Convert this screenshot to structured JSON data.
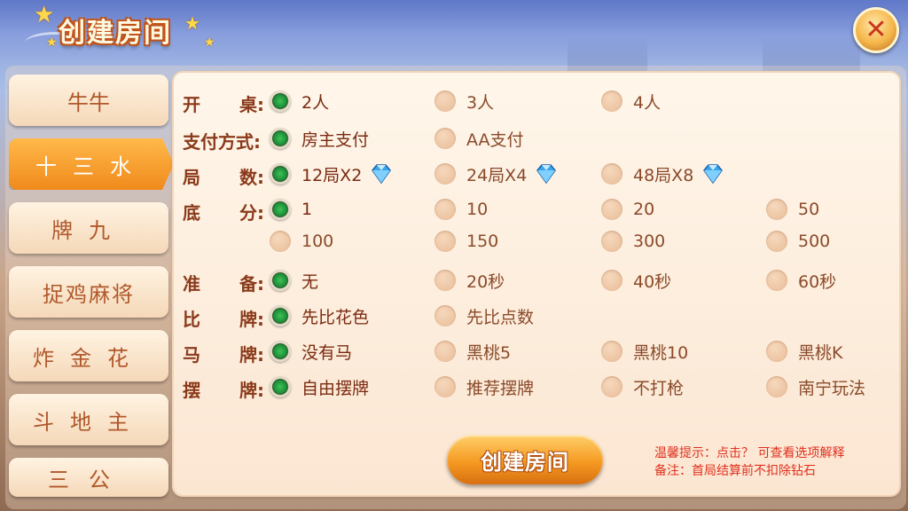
{
  "header": {
    "title": "创建房间",
    "close_icon": "close-icon"
  },
  "game_tabs": [
    {
      "label": "牛牛",
      "active": false
    },
    {
      "label": "十三水",
      "active": true
    },
    {
      "label": "牌九",
      "active": false
    },
    {
      "label": "捉鸡麻将",
      "active": false
    },
    {
      "label": "炸金花",
      "active": false
    },
    {
      "label": "斗地主",
      "active": false
    },
    {
      "label": "三公",
      "active": false
    }
  ],
  "settings": {
    "table_size": {
      "label_a": "开",
      "label_b": "桌:",
      "options": [
        "2人",
        "3人",
        "4人"
      ],
      "selected": 0
    },
    "payment": {
      "label": "支付方式:",
      "options": [
        "房主支付",
        "AA支付"
      ],
      "selected": 0
    },
    "rounds": {
      "label_a": "局",
      "label_b": "数:",
      "options": [
        "12局X2",
        "24局X4",
        "48局X8"
      ],
      "selected": 0,
      "icon": "diamond-icon"
    },
    "base_score": {
      "label_a": "底",
      "label_b": "分:",
      "options": [
        "1",
        "10",
        "20",
        "50",
        "100",
        "150",
        "300",
        "500"
      ],
      "selected": 0
    },
    "ready": {
      "label_a": "准",
      "label_b": "备:",
      "options": [
        "无",
        "20秒",
        "40秒",
        "60秒"
      ],
      "selected": 0
    },
    "compare": {
      "label_a": "比",
      "label_b": "牌:",
      "options": [
        "先比花色",
        "先比点数"
      ],
      "selected": 0
    },
    "horse_card": {
      "label_a": "马",
      "label_b": "牌:",
      "options": [
        "没有马",
        "黑桃5",
        "黑桃10",
        "黑桃K"
      ],
      "selected": 0
    },
    "arrange": {
      "label_a": "摆",
      "label_b": "牌:",
      "options": [
        "自由摆牌",
        "推荐摆牌",
        "不打枪",
        "南宁玩法"
      ],
      "selected": 0
    }
  },
  "create_button": "创建房间",
  "hints": {
    "line1": "温馨提示：点击？ 可查看选项解释",
    "line2": "备注：首局结算前不扣除钻石"
  },
  "colors": {
    "accent": "#f08a1c",
    "label": "#8a3a1a",
    "hint": "#e0301e",
    "radio_selected": "#1a8a34"
  }
}
